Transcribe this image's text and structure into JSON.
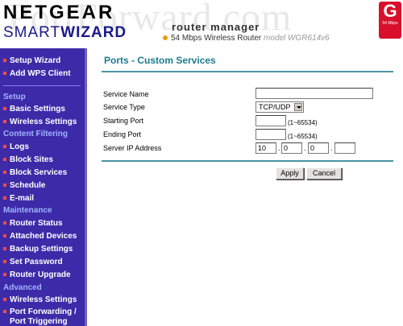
{
  "header": {
    "logo_top": "NETGEAR",
    "logo_bottom_plain": "SMART",
    "logo_bottom_bold": "WIZARD",
    "watermark": "PortForward.com",
    "title": "router manager",
    "subtitle": "54 Mbps Wireless Router",
    "model": "model WGR614v6",
    "badge_letter": "G",
    "badge_text": "54 Mbps"
  },
  "sidebar": {
    "top_items": [
      "Setup Wizard",
      "Add WPS Client"
    ],
    "sections": [
      {
        "heading": "Setup",
        "items": [
          "Basic Settings",
          "Wireless Settings"
        ]
      },
      {
        "heading": "Content Filtering",
        "items": [
          "Logs",
          "Block Sites",
          "Block Services",
          "Schedule",
          "E-mail"
        ]
      },
      {
        "heading": "Maintenance",
        "items": [
          "Router Status",
          "Attached Devices",
          "Backup Settings",
          "Set Password",
          "Router Upgrade"
        ]
      },
      {
        "heading": "Advanced",
        "items": [
          "Wireless Settings",
          "Port Forwarding /",
          "Port Triggering"
        ]
      }
    ]
  },
  "main": {
    "title": "Ports - Custom Services",
    "labels": {
      "service_name": "Service Name",
      "service_type": "Service Type",
      "starting_port": "Starting Port",
      "ending_port": "Ending Port",
      "server_ip": "Server IP Address"
    },
    "service_name_value": "",
    "service_type_value": "TCP/UDP",
    "starting_port_value": "",
    "ending_port_value": "",
    "port_range_hint": "(1~65534)",
    "ip": [
      "10",
      "0",
      "0",
      ""
    ],
    "apply_label": "Apply",
    "cancel_label": "Cancel"
  }
}
